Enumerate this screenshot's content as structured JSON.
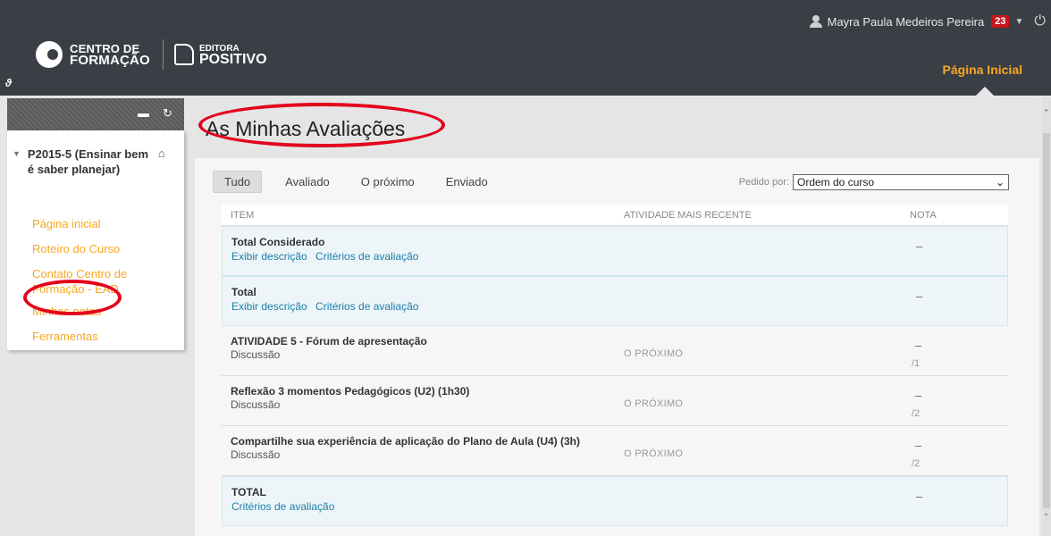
{
  "header": {
    "user_name": "Mayra Paula Medeiros Pereira",
    "notification_count": "23",
    "logo1_line1": "CENTRO DE",
    "logo1_line2": "FORMAÇÃO",
    "logo2_line1": "EDITORA",
    "logo2_line2": "POSITIVO",
    "home_tab": "Página Inicial"
  },
  "sidebar": {
    "course_title": "P2015-5 (Ensinar bem é saber planejar)",
    "items": [
      {
        "label": "Página inicial"
      },
      {
        "label": "Roteiro do Curso"
      },
      {
        "label": "Contato Centro de Formação - EAD"
      },
      {
        "label": "Minhas notas"
      },
      {
        "label": "Ferramentas"
      }
    ]
  },
  "main": {
    "title": "As Minhas Avaliações",
    "filters": [
      "Tudo",
      "Avaliado",
      "O próximo",
      "Enviado"
    ],
    "sort_label": "Pedido por:",
    "sort_value": "Ordem do curso",
    "columns": [
      "ITEM",
      "ATIVIDADE MAIS RECENTE",
      "NOTA"
    ],
    "rows": [
      {
        "name": "Total Considerado",
        "link1": "Exibir descrição",
        "link2": "Critérios de avaliação",
        "grade": "–"
      },
      {
        "name": "Total",
        "link1": "Exibir descrição",
        "link2": "Critérios de avaliação",
        "grade": "–"
      },
      {
        "name": "ATIVIDADE 5 - Fórum de apresentação",
        "sub": "Discussão",
        "activity": "O PRÓXIMO",
        "grade": "–",
        "max": "/1"
      },
      {
        "name": "Reflexão 3 momentos Pedagógicos (U2) (1h30)",
        "sub": "Discussão",
        "activity": "O PRÓXIMO",
        "grade": "–",
        "max": "/2"
      },
      {
        "name": "Compartilhe sua experiência de aplicação do Plano de Aula (U4) (3h)",
        "sub": "Discussão",
        "activity": "O PRÓXIMO",
        "grade": "–",
        "max": "/2"
      },
      {
        "name": "TOTAL",
        "link1": "Critérios de avaliação",
        "grade": "–"
      }
    ]
  },
  "colors": {
    "accent": "#f7a823",
    "link": "#1a7fa8",
    "annotation": "#e3001b"
  }
}
